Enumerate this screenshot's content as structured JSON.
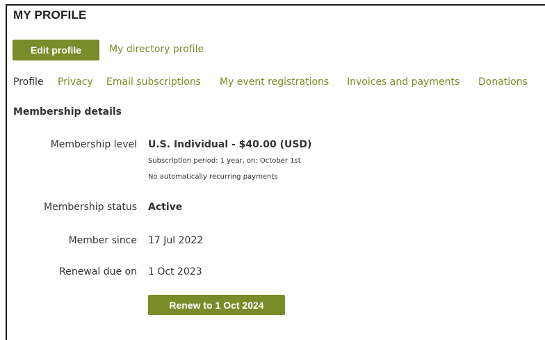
{
  "page": {
    "title": "MY PROFILE"
  },
  "header": {
    "edit_button_label": "Edit profile",
    "directory_link_label": "My directory profile"
  },
  "tabs": [
    {
      "label": "Profile",
      "active": true
    },
    {
      "label": "Privacy",
      "active": false
    },
    {
      "label": "Email subscriptions",
      "active": false
    },
    {
      "label": "My event registrations",
      "active": false
    },
    {
      "label": "Invoices and payments",
      "active": false
    },
    {
      "label": "Donations",
      "active": false
    }
  ],
  "membership": {
    "section_title": "Membership details",
    "level_label": "Membership level",
    "level_value": "U.S. Individual - $40.00 (USD)",
    "subscription_period": "Subscription period: 1 year, on: October 1st",
    "recurring_note": "No automatically recurring payments",
    "status_label": "Membership status",
    "status_value": "Active",
    "since_label": "Member since",
    "since_value": "17 Jul 2022",
    "renewal_label": "Renewal due on",
    "renewal_value": "1 Oct 2023",
    "renew_button_label": "Renew to 1 Oct 2024"
  },
  "colors": {
    "accent": "#7a8c2a",
    "text": "#333333",
    "border": "#1a1a1a"
  }
}
